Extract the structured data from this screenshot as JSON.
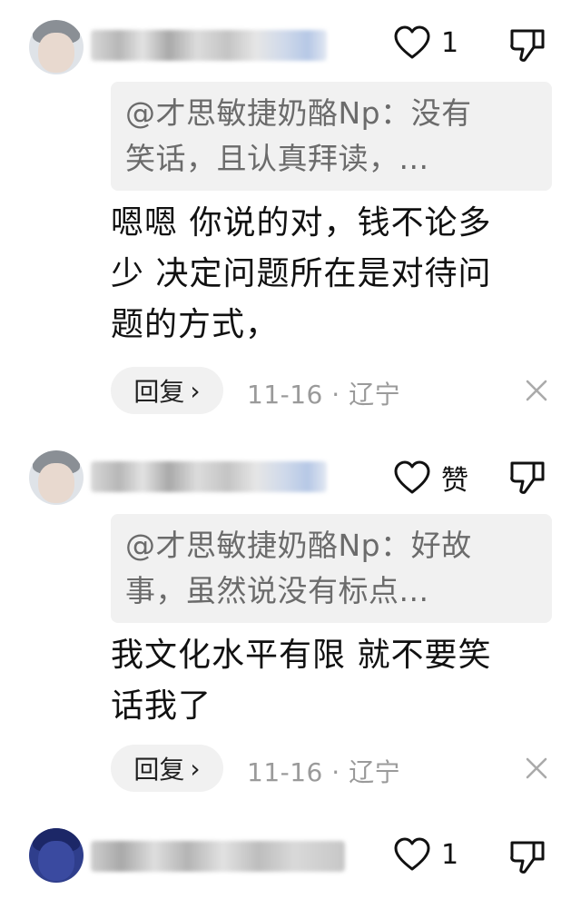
{
  "comments": [
    {
      "like_count": "1",
      "quote_text": "@才思敏捷奶酪Np：没有笑话，且认真拜读，...",
      "quote_line1": "@才思敏捷奶酪Np：没有",
      "quote_line2": "笑话，且认真拜读，...",
      "body_line1": "嗯嗯 你说的对，钱不论多",
      "body_line2": "少 决定问题所在是对待问",
      "body_line3": "题的方式，",
      "reply_label": "回复",
      "reply_chevron": "›",
      "date": "11-16",
      "location": "辽宁"
    },
    {
      "like_label": "赞",
      "quote_line1": "@才思敏捷奶酪Np：好故",
      "quote_line2": "事，虽然说没有标点...",
      "body_line1": "我文化水平有限 就不要笑",
      "body_line2": "话我了",
      "reply_label": "回复",
      "reply_chevron": "›",
      "date": "11-16",
      "location": "辽宁"
    },
    {
      "like_count": "1"
    }
  ],
  "icons": {
    "like": "heart-outline-icon",
    "dislike": "thumbs-down-outline-icon",
    "close": "close-x-icon"
  },
  "colors": {
    "background": "#ffffff",
    "quote_bg": "#f1f1f1",
    "meta_text": "#9a9a9a"
  }
}
